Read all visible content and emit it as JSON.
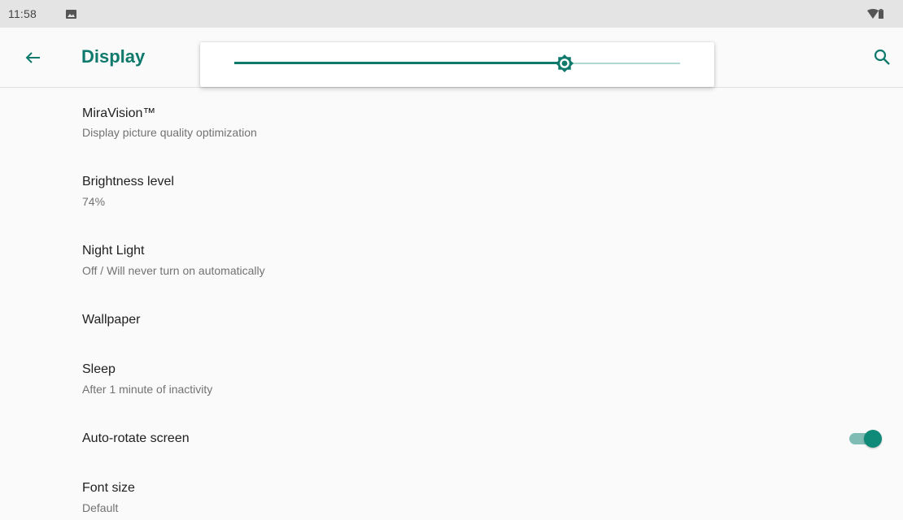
{
  "status_bar": {
    "time": "11:58",
    "left_icon": "image-icon",
    "right_icons": [
      "wifi-icon",
      "battery-icon"
    ]
  },
  "app_bar": {
    "title": "Display",
    "back_icon": "arrow-back-icon",
    "search_icon": "search-icon",
    "accent_color": "#0f7a6c"
  },
  "brightness_popup": {
    "level_fraction": 0.74,
    "thumb_icon": "brightness-icon",
    "active_color": "#0f7a6c",
    "inactive_color": "#b2d8d3"
  },
  "settings": {
    "miravision": {
      "title": "MiraVision™",
      "summary": "Display picture quality optimization"
    },
    "brightness": {
      "title": "Brightness level",
      "summary": "74%"
    },
    "night_light": {
      "title": "Night Light",
      "summary": "Off / Will never turn on automatically"
    },
    "wallpaper": {
      "title": "Wallpaper"
    },
    "sleep": {
      "title": "Sleep",
      "summary": "After 1 minute of inactivity"
    },
    "auto_rotate": {
      "title": "Auto-rotate screen",
      "enabled": true
    },
    "font_size": {
      "title": "Font size",
      "summary": "Default"
    }
  }
}
